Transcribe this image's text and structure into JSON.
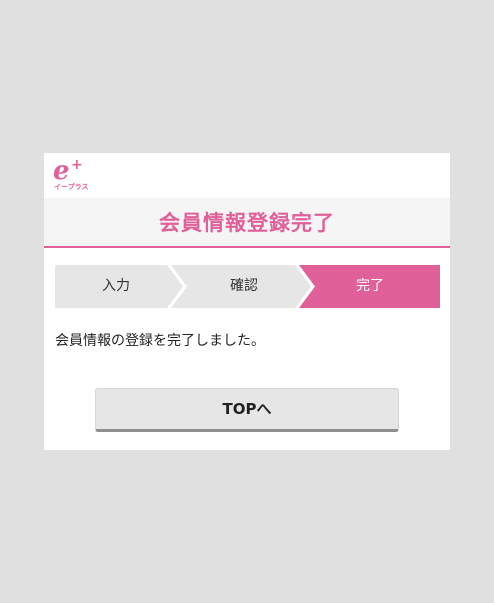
{
  "brand": {
    "logo_letter": "e",
    "logo_plus": "+",
    "logo_sub": "イープラス",
    "color": "#e0609a"
  },
  "page": {
    "title": "会員情報登録完了"
  },
  "steps": [
    {
      "label": "入力",
      "active": false
    },
    {
      "label": "確認",
      "active": false
    },
    {
      "label": "完了",
      "active": true
    }
  ],
  "message": "会員情報の登録を完了しました。",
  "top_button_label": "TOPへ"
}
